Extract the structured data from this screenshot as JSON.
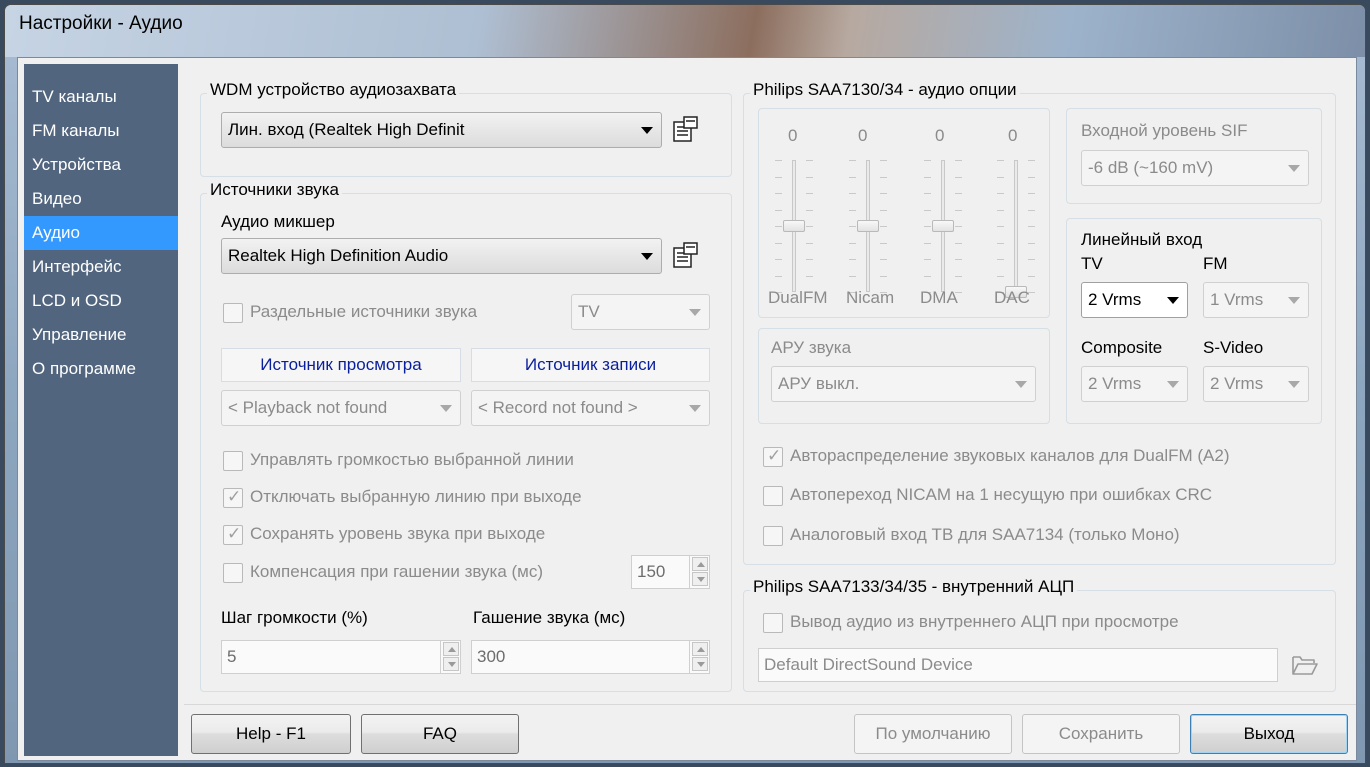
{
  "window": {
    "title": "Настройки - Аудио"
  },
  "sidebar": {
    "items": [
      {
        "label": "TV каналы"
      },
      {
        "label": "FM каналы"
      },
      {
        "label": "Устройства"
      },
      {
        "label": "Видео"
      },
      {
        "label": "Аудио",
        "active": true
      },
      {
        "label": "Интерфейс"
      },
      {
        "label": "LCD и OSD"
      },
      {
        "label": "Управление"
      },
      {
        "label": "О программе"
      }
    ]
  },
  "wdm": {
    "group_title": "WDM устройство аудиозахвата",
    "device": "Лин. вход (Realtek High Definit"
  },
  "sources": {
    "group_title": "Источники звука",
    "mixer_label": "Аудио микшер",
    "mixer_value": "Realtek High Definition Audio",
    "separate_sources": {
      "label": "Раздельные источники звука",
      "checked": false
    },
    "separate_value": "TV",
    "playback_header": "Источник просмотра",
    "record_header": "Источник записи",
    "playback_value": "< Playback not found",
    "record_value": "< Record not found >",
    "options": [
      {
        "label": "Управлять громкостью выбранной линии",
        "checked": false
      },
      {
        "label": "Отключать выбранную линию при выходе",
        "checked": true
      },
      {
        "label": "Сохранять уровень звука при выходе",
        "checked": true
      },
      {
        "label": "Компенсация при гашении звука (мс)",
        "checked": false
      }
    ],
    "compensation_value": "150",
    "volume_step_label": "Шаг громкости (%)",
    "volume_step_value": "5",
    "mute_label": "Гашение звука (мс)",
    "mute_value": "300"
  },
  "philips_audio": {
    "group_title": "Philips SAA7130/34 - аудио опции",
    "sliders": [
      {
        "name": "DualFM",
        "value": "0",
        "level": 0.5
      },
      {
        "name": "Nicam",
        "value": "0",
        "level": 0.5
      },
      {
        "name": "DMA",
        "value": "0",
        "level": 0.5
      },
      {
        "name": "DAC",
        "value": "0",
        "level": 0.0
      }
    ],
    "sif_label": "Входной уровень SIF",
    "sif_value": "-6 dB (~160 mV)",
    "agc_label": "АРУ звука",
    "agc_value": "АРУ выкл.",
    "line_in_label": "Линейный вход",
    "tv_label": "TV",
    "tv_value": "2 Vrms",
    "fm_label": "FM",
    "fm_value": "1 Vrms",
    "composite_label": "Composite",
    "composite_value": "2 Vrms",
    "svideo_label": "S-Video",
    "svideo_value": "2 Vrms",
    "options": [
      {
        "label": "Автораспределение звуковых каналов для DualFM (A2)",
        "checked": true
      },
      {
        "label": "Автопереход NICAM на 1 несущую при ошибках CRC",
        "checked": false
      },
      {
        "label": "Аналоговый вход ТВ для SAA7134 (только Моно)",
        "checked": false
      }
    ]
  },
  "philips_adc": {
    "group_title": "Philips SAA7133/34/35 - внутренний АЦП",
    "output_option": {
      "label": "Вывод аудио из внутреннего АЦП при просмотре",
      "checked": false
    },
    "device": "Default DirectSound Device"
  },
  "buttons": {
    "help": "Help - F1",
    "faq": "FAQ",
    "defaults": "По умолчанию",
    "save": "Сохранить",
    "exit": "Выход"
  }
}
